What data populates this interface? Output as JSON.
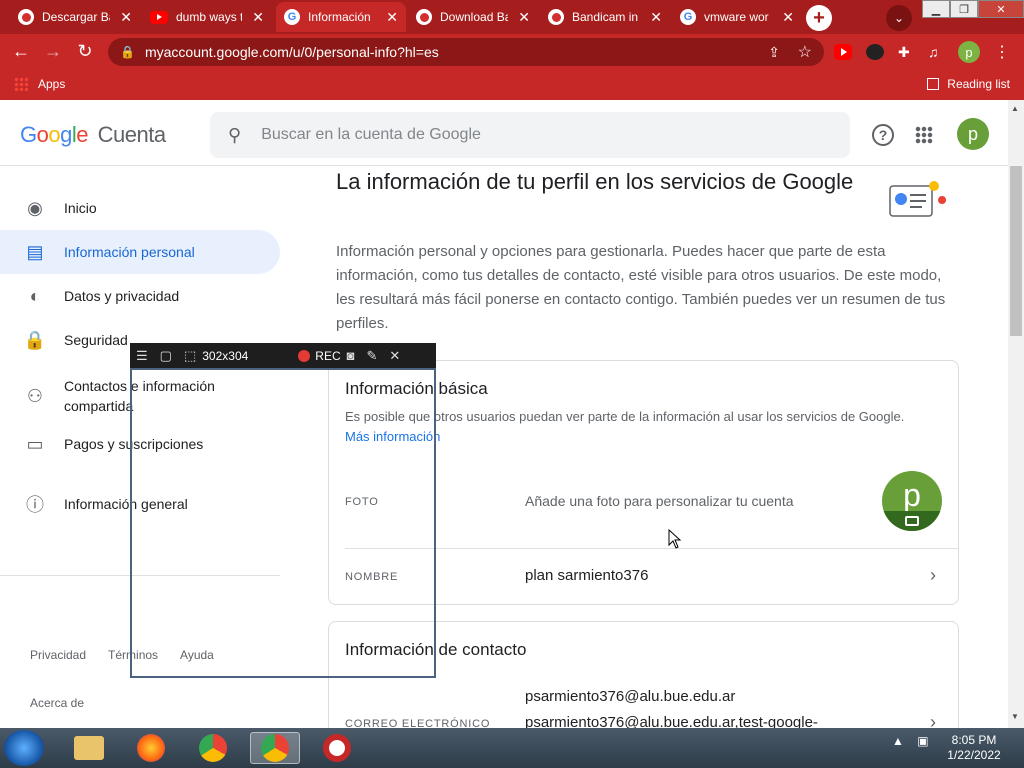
{
  "browser": {
    "tabs": [
      {
        "title": "Descargar Ba",
        "favicon": "bandicam-icon",
        "active": false
      },
      {
        "title": "dumb ways t",
        "favicon": "youtube-icon",
        "active": false
      },
      {
        "title": "Información",
        "favicon": "google-icon",
        "active": true
      },
      {
        "title": "Download Ba",
        "favicon": "bandicam-icon",
        "active": false
      },
      {
        "title": "Bandicam in",
        "favicon": "bandicam-icon",
        "active": false
      },
      {
        "title": "vmware wor",
        "favicon": "google-icon",
        "active": false
      }
    ],
    "url": "myaccount.google.com/u/0/personal-info?hl=es",
    "profile_initial": "p",
    "bookmarks": {
      "apps_label": "Apps",
      "reading_list_label": "Reading list"
    }
  },
  "header": {
    "logo_g1": "G",
    "logo_o1": "o",
    "logo_o2": "o",
    "logo_g2": "g",
    "logo_l": "l",
    "logo_e": "e",
    "product": "Cuenta",
    "search_placeholder": "Buscar en la cuenta de Google",
    "avatar_initial": "p"
  },
  "sidebar": {
    "items": [
      {
        "label": "Inicio",
        "icon": "account-circle-icon"
      },
      {
        "label": "Información personal",
        "icon": "id-card-icon"
      },
      {
        "label": "Datos y privacidad",
        "icon": "toggle-icon"
      },
      {
        "label": "Seguridad",
        "icon": "lock-icon"
      },
      {
        "label": "Contactos e información compartida",
        "icon": "people-icon"
      },
      {
        "label": "Pagos y suscripciones",
        "icon": "credit-card-icon"
      },
      {
        "label": "Información general",
        "icon": "info-icon"
      }
    ],
    "footer": {
      "privacy": "Privacidad",
      "terms": "Términos",
      "help": "Ayuda",
      "about": "Acerca de"
    }
  },
  "main": {
    "title": "La información de tu perfil en los servicios de Google",
    "intro": "Información personal y opciones para gestionarla. Puedes hacer que parte de esta información, como tus detalles de contacto, esté visible para otros usuarios. De este modo, les resultará más fácil ponerse en contacto contigo. También puedes ver un resumen de tus perfiles.",
    "basic": {
      "title": "Información básica",
      "desc": "Es posible que otros usuarios puedan ver parte de la información al usar los servicios de Google.",
      "more_link": "Más información",
      "photo_label": "FOTO",
      "photo_hint": "Añade una foto para personalizar tu cuenta",
      "photo_initial": "p",
      "name_label": "NOMBRE",
      "name_value": "plan sarmiento376"
    },
    "contact": {
      "title": "Información de contacto",
      "email_label": "CORREO ELECTRÓNICO",
      "email_primary": "psarmiento376@alu.bue.edu.ar",
      "email_secondary": "psarmiento376@alu.bue.edu.ar,test-google-"
    }
  },
  "bandicam": {
    "size_label": "302x304",
    "rec_label": "REC"
  },
  "taskbar": {
    "time": "8:05 PM",
    "date": "1/22/2022"
  },
  "colors": {
    "chrome_red": "#c62828",
    "google_blue": "#1a73e8",
    "active_nav_bg": "#e8f0fe"
  }
}
